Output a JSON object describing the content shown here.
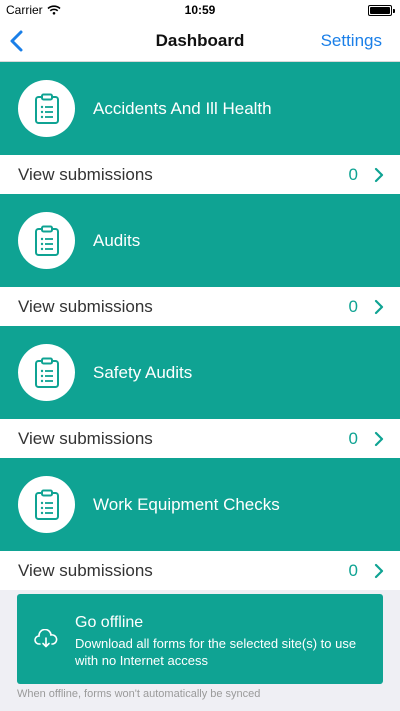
{
  "status_bar": {
    "carrier": "Carrier",
    "time": "10:59"
  },
  "nav": {
    "title": "Dashboard",
    "settings_label": "Settings"
  },
  "forms": [
    {
      "title": "Accidents And Ill Health",
      "view_label": "View submissions",
      "count": "0"
    },
    {
      "title": "Audits",
      "view_label": "View submissions",
      "count": "0"
    },
    {
      "title": "Safety Audits",
      "view_label": "View submissions",
      "count": "0"
    },
    {
      "title": "Work Equipment Checks",
      "view_label": "View submissions",
      "count": "0"
    }
  ],
  "offline": {
    "title": "Go offline",
    "description": "Download all forms for the selected site(s) to use with no Internet access",
    "note": "When offline, forms won't automatically be synced"
  },
  "icons": {
    "card_icon": "clipboard-icon",
    "back": "chevron-left-icon",
    "row_chevron": "chevron-right-icon",
    "offline": "cloud-download-icon"
  },
  "colors": {
    "accent": "#0fa393",
    "link": "#1a7fe8",
    "background": "#efeff4"
  }
}
